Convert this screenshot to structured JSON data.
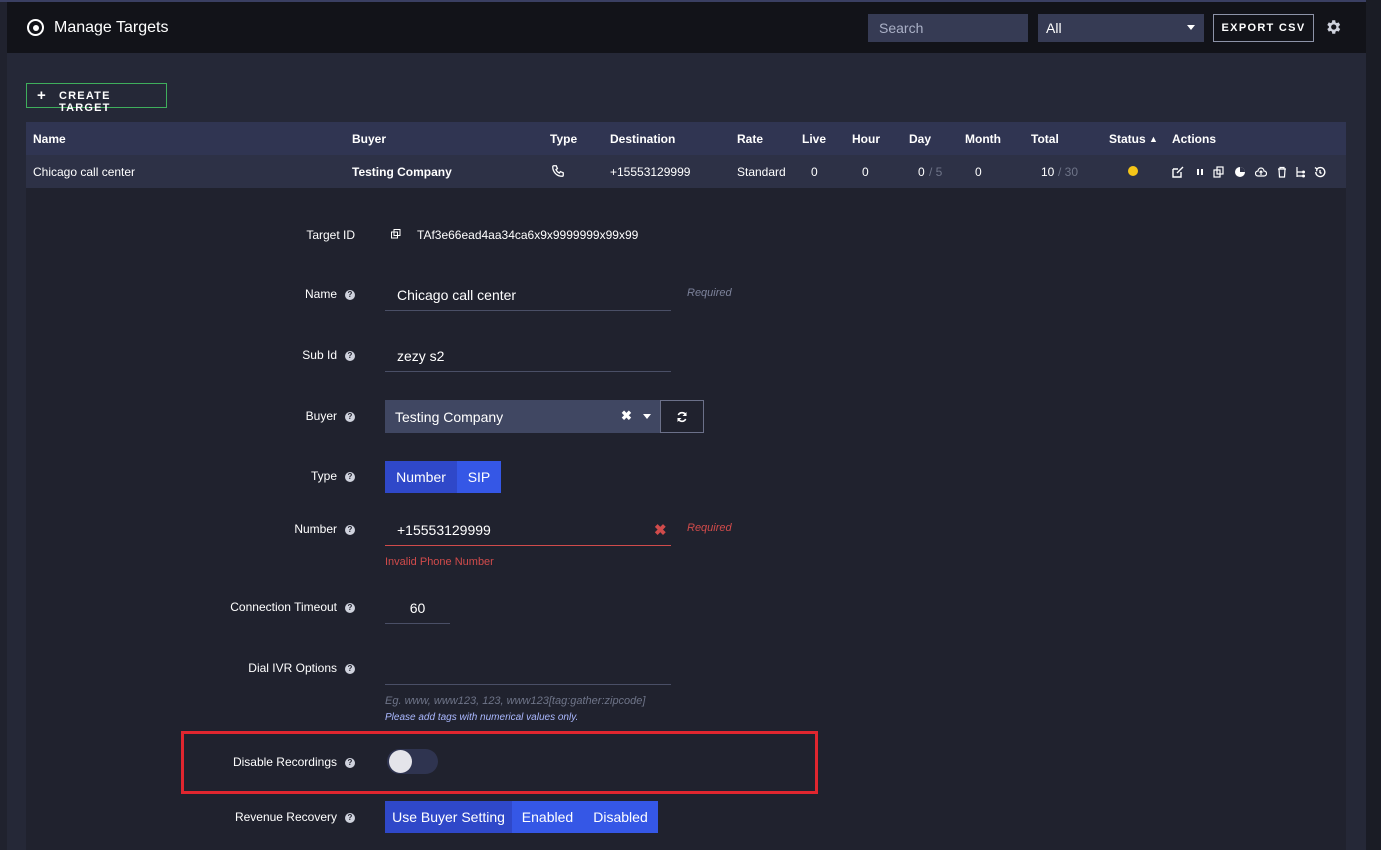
{
  "header": {
    "title": "Manage Targets",
    "search_placeholder": "Search",
    "filter_value": "All",
    "export_label": "EXPORT CSV"
  },
  "toolbar": {
    "create_label": "CREATE TARGET"
  },
  "table": {
    "columns": [
      "Name",
      "Buyer",
      "Type",
      "Destination",
      "Rate",
      "Live",
      "Hour",
      "Day",
      "Month",
      "Total",
      "Status",
      "Actions"
    ],
    "row": {
      "name": "Chicago call center",
      "buyer": "Testing Company",
      "type_icon": "phone-icon",
      "destination": "+15553129999",
      "rate": "Standard",
      "live": "0",
      "hour": "0",
      "day": "0",
      "day_cap": "/ 5",
      "month": "0",
      "total": "10",
      "total_cap": "/ 30",
      "status_color": "#f5c518"
    },
    "sort_indicator": "▲"
  },
  "form": {
    "target_id_label": "Target ID",
    "target_id": "TAf3e66ead4aa34ca6x9x9999999x99x99",
    "name_label": "Name",
    "name_value": "Chicago call center",
    "required": "Required",
    "sub_id_label": "Sub Id",
    "sub_id_value": "zezy s2",
    "buyer_label": "Buyer",
    "buyer_value": "Testing Company",
    "type_label": "Type",
    "type_options": [
      "Number",
      "SIP"
    ],
    "number_label": "Number",
    "number_value": "+15553129999",
    "number_error": "Invalid Phone Number",
    "timeout_label": "Connection Timeout",
    "timeout_value": "60",
    "dial_ivr_label": "Dial IVR Options",
    "dial_ivr_placeholder": "Eg. www, www123, 123, www123[tag:gather:zipcode]",
    "dial_ivr_note": "Please add tags with numerical values only.",
    "disable_recordings_label": "Disable Recordings",
    "disable_recordings_on": false,
    "revenue_recovery_label": "Revenue Recovery",
    "revenue_options": [
      "Use Buyer Setting",
      "Enabled",
      "Disabled"
    ]
  },
  "colors": {
    "accent_blue": "#3557e6",
    "selected_blue": "#2f48c9",
    "error_red": "#d04b4b",
    "highlight_red": "#e0262f",
    "create_green": "#3fae5c"
  }
}
